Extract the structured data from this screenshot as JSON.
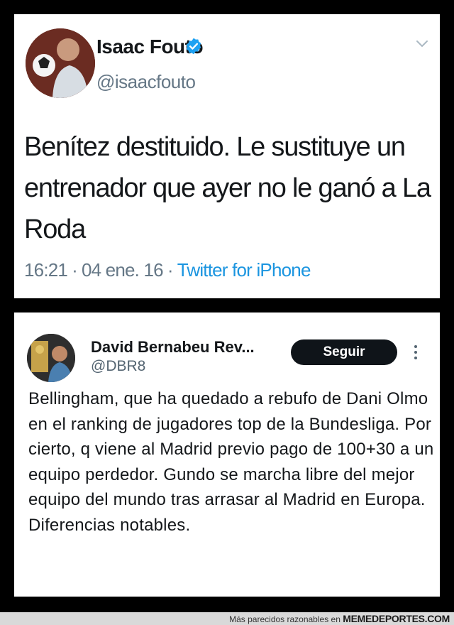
{
  "tweet1": {
    "name": "Isaac Fouto",
    "handle": "@isaacfouto",
    "text": "Benítez destituido. Le sustituye un entrenador que ayer no le ganó a La Roda",
    "time": "16:21",
    "date": "04 ene. 16",
    "source": "Twitter for iPhone",
    "verified_color": "#1da1f2"
  },
  "tweet2": {
    "name": "David Bernabeu Rev...",
    "handle": "@DBR8",
    "follow_label": "Seguir",
    "text": "Bellingham, que ha quedado a rebufo de Dani Olmo en el ranking de jugadores top de la Bundesliga. Por cierto, q viene al Madrid previo pago de 100+30 a un equipo perdedor. Gundo se marcha libre del mejor equipo del mundo tras arrasar al Madrid en Europa. Diferencias notables."
  },
  "footer": {
    "text": "Más parecidos razonables en",
    "site": "MEMEDEPORTES.COM"
  },
  "icons": [
    "verified-badge-icon",
    "chevron-down-icon",
    "more-vertical-icon"
  ]
}
